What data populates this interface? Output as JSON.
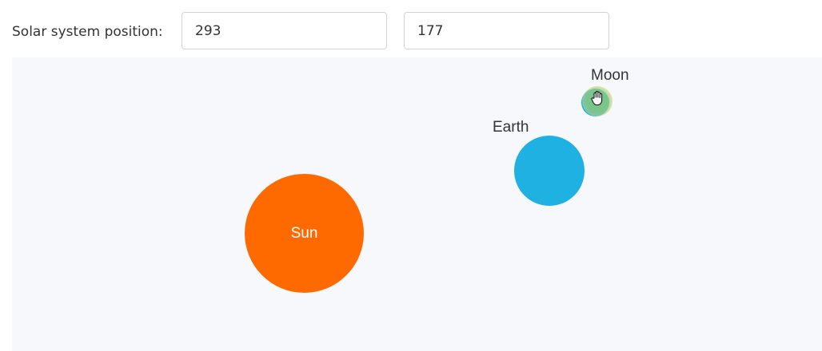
{
  "toolbar": {
    "label": "Solar system position:",
    "x_value": "293",
    "y_value": "177"
  },
  "bodies": {
    "sun": {
      "label": "Sun",
      "color": "#ff6a00"
    },
    "earth": {
      "label": "Earth",
      "color": "#1fb1e2"
    },
    "moon": {
      "label": "Moon",
      "color": "#1fb1e2"
    }
  },
  "cursor": {
    "icon": "hand-grab-icon"
  },
  "colors": {
    "stage_background": "#f7f8fb",
    "text": "#333333",
    "input_border": "#ced4da"
  }
}
